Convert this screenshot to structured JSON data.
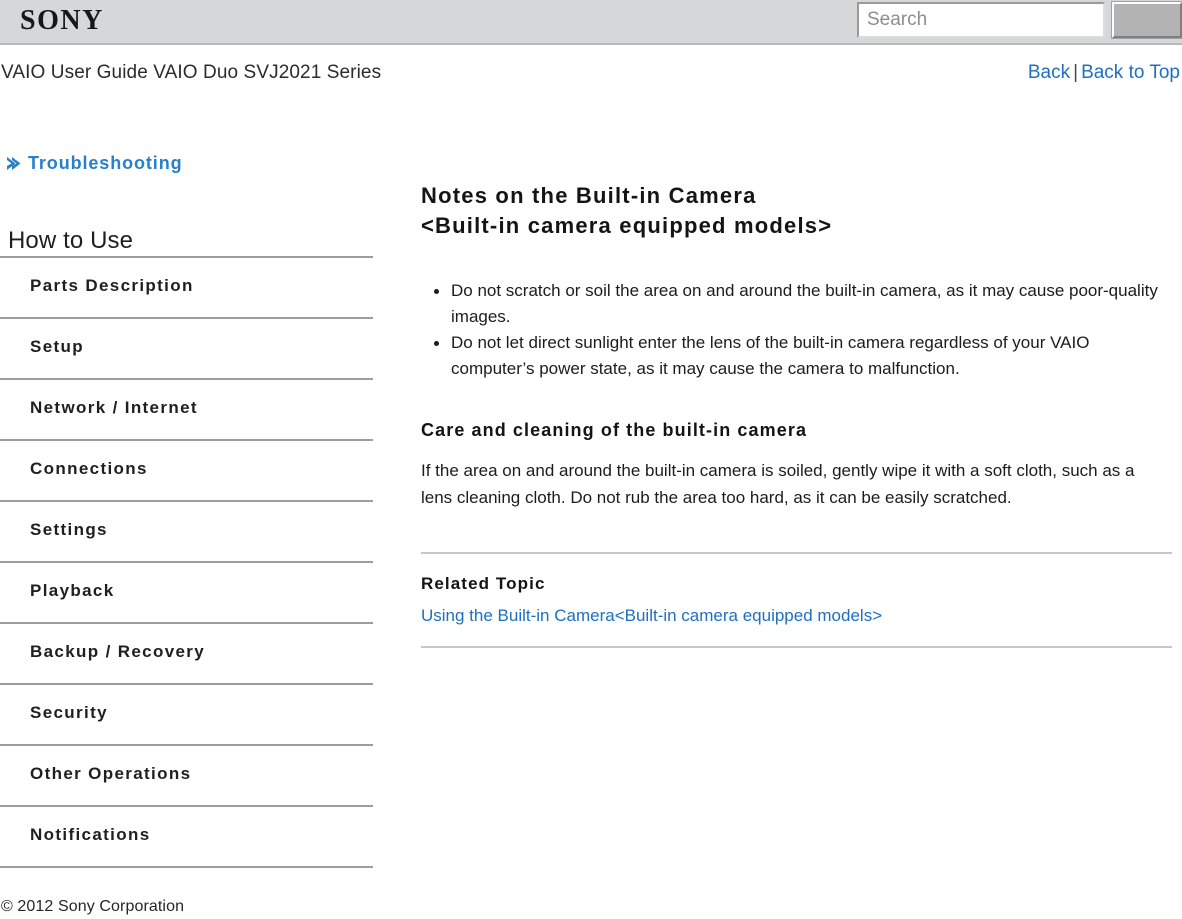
{
  "header": {
    "logo_text": "SONY",
    "logo_icon": "sony-wordmark",
    "search": {
      "placeholder": "Search",
      "value": "",
      "button_label": "",
      "button_icon": "search-submit-button"
    }
  },
  "titlebar": {
    "guide_title": "VAIO User Guide VAIO Duo SVJ2021 Series",
    "back_label": "Back",
    "separator": "|",
    "back_to_top_label": "Back to Top"
  },
  "sidebar": {
    "troubleshooting": {
      "label": "Troubleshooting",
      "icon": "chevron-right-icon"
    },
    "section_heading": "How to Use",
    "items": [
      {
        "label": "Parts Description"
      },
      {
        "label": "Setup"
      },
      {
        "label": "Network / Internet"
      },
      {
        "label": "Connections"
      },
      {
        "label": "Settings"
      },
      {
        "label": "Playback"
      },
      {
        "label": "Backup / Recovery"
      },
      {
        "label": "Security"
      },
      {
        "label": "Other Operations"
      },
      {
        "label": "Notifications"
      }
    ]
  },
  "main": {
    "title_line1": "Notes on the Built-in Camera",
    "title_line2": "<Built-in camera equipped models>",
    "bullets": [
      "Do not scratch or soil the area on and around the built-in camera, as it may cause poor-quality images.",
      "Do not let direct sunlight enter the lens of the built-in camera regardless of your VAIO computer’s power state, as it may cause the camera to malfunction."
    ],
    "care_heading": "Care and cleaning of the built-in camera",
    "care_body": "If the area on and around the built-in camera is soiled, gently wipe it with a soft cloth, such as a lens cleaning cloth. Do not rub the area too hard, as it can be easily scratched.",
    "related_heading": "Related Topic",
    "related_link": "Using the Built-in Camera<Built-in camera equipped models>"
  },
  "footer": {
    "copyright": "© 2012 Sony Corporation"
  },
  "colors": {
    "header_bg": "#d6d7d9",
    "link_blue": "#1e6fc4",
    "accent_blue": "#2a7fc9",
    "rule_gray": "#9d9d9d",
    "content_rule_gray": "#c7c7c7"
  }
}
